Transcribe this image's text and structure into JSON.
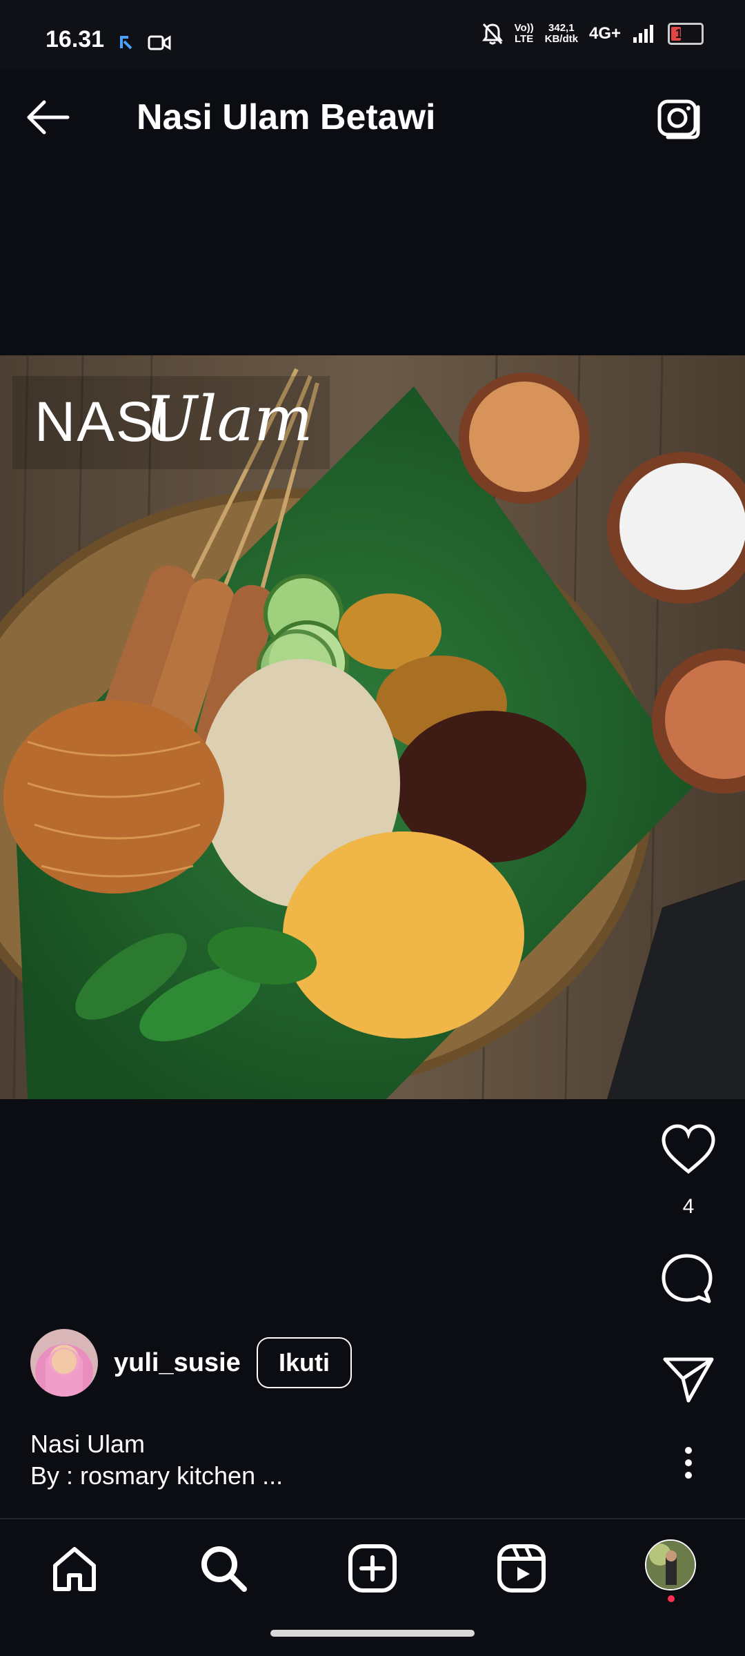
{
  "status_bar": {
    "time": "16.31",
    "network_rate_top": "342,1",
    "network_rate_bottom": "KB/dtk",
    "volte_top": "Vo))",
    "volte_bottom": "LTE",
    "network": "4G+",
    "battery": "17",
    "icons": [
      "notification-app-icon",
      "video-record-icon",
      "mute-bell-icon",
      "volte-icon",
      "signal-icon",
      "battery-icon"
    ]
  },
  "header": {
    "title": "Nasi Ulam Betawi",
    "back_icon": "arrow-left-icon",
    "camera_icon": "camera-icon"
  },
  "post": {
    "image_overlay_text_1": "NASI",
    "image_overlay_text_2": "Ulam",
    "likes": "4",
    "username": "yuli_susie",
    "follow_label": "Ikuti",
    "caption_line1": "Nasi Ulam",
    "caption_line2": "By : rosmary kitchen ..."
  },
  "nav": {
    "items": [
      "home-icon",
      "search-icon",
      "add-icon",
      "reels-icon",
      "profile-avatar"
    ]
  },
  "colors": {
    "background": "#0b0d12",
    "accent_dot": "#ff2e55",
    "text": "#ffffff"
  }
}
